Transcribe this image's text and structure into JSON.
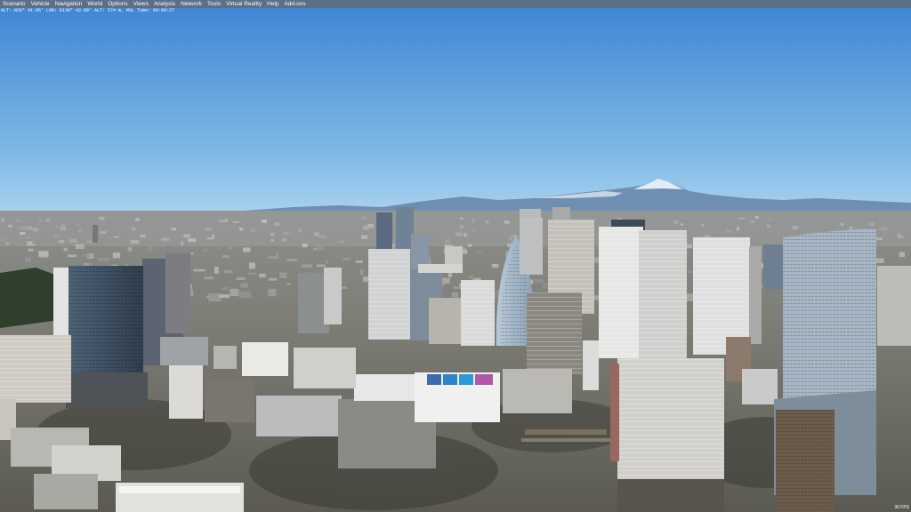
{
  "menu": {
    "items": [
      "Scenario",
      "Vehicle",
      "Navigation",
      "World",
      "Options",
      "Views",
      "Analysis",
      "Network",
      "Tools",
      "Virtual Reality",
      "Help",
      "Add-ons"
    ]
  },
  "status": {
    "text": "ALT: N35° 41.95'  LON: E139° 42.00'  ALT: 574 m, MSL  Time: 08:09:27"
  },
  "fps": "30 FPS",
  "colors": {
    "menubar": "#5b6f87",
    "sky_top": "#3f87d4",
    "sky_horizon": "#a9d2ef",
    "ground": "#6a6b63"
  }
}
